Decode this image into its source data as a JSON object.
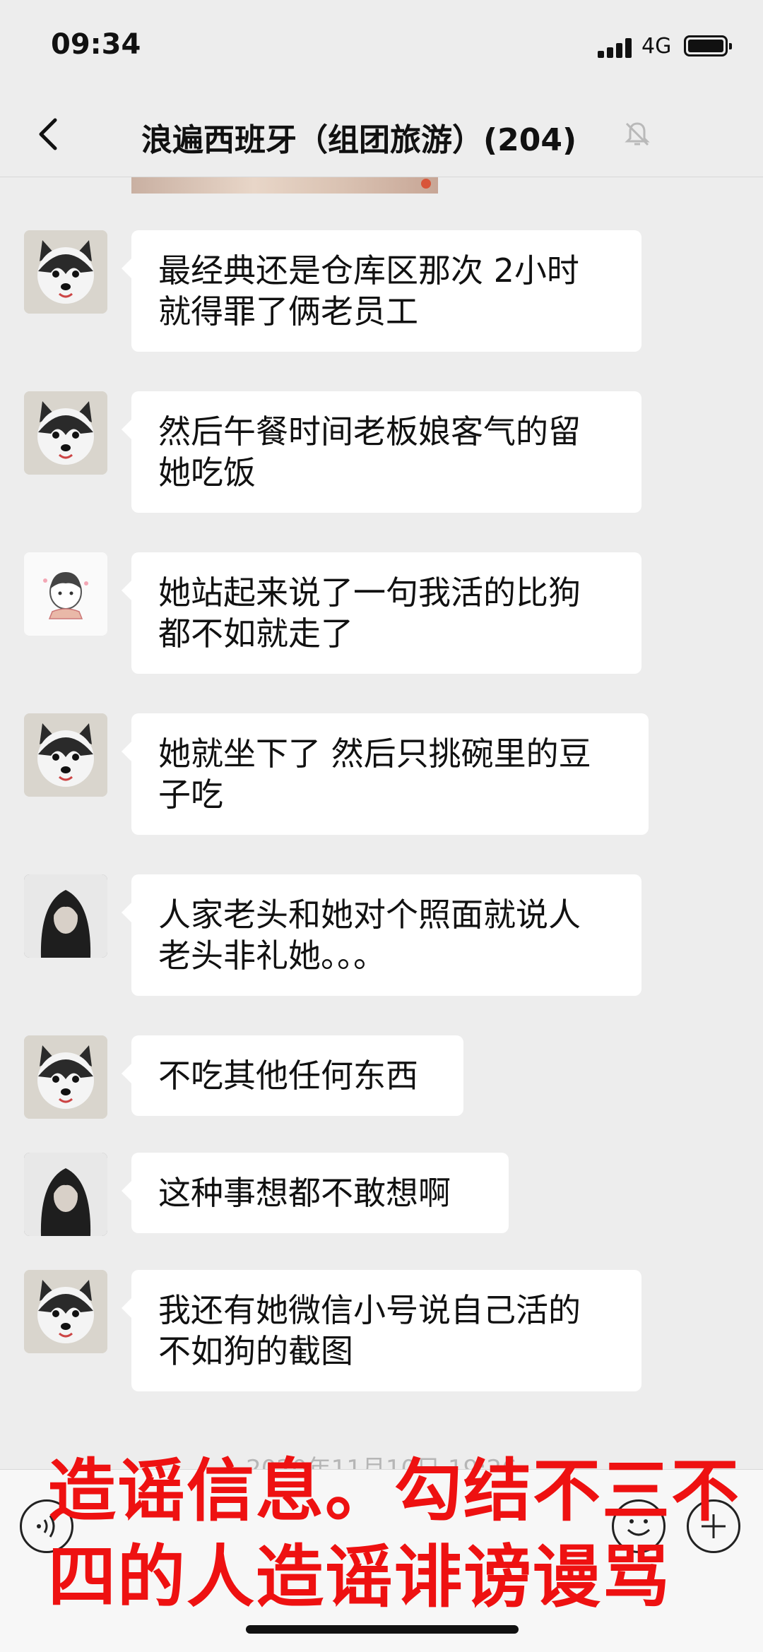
{
  "status_bar": {
    "time": "09:34",
    "network": "4G"
  },
  "nav": {
    "title": "浪遍西班牙（组团旅游）(204)",
    "icons": [
      "back-chevron-icon",
      "mute-bell-icon"
    ]
  },
  "messages": [
    {
      "avatar": "husky-avatar",
      "lines": [
        "最经典还是仓库区那次 2小时",
        "就得罪了俩老员工"
      ]
    },
    {
      "avatar": "husky-avatar",
      "lines": [
        "然后午餐时间老板娘客气的留",
        "她吃饭"
      ]
    },
    {
      "avatar": "cartoon-girl-avatar",
      "lines": [
        "她站起来说了一句我活的比狗",
        "都不如就走了"
      ]
    },
    {
      "avatar": "husky-avatar",
      "lines": [
        "她就坐下了 然后只挑碗里的豆",
        "子吃"
      ]
    },
    {
      "avatar": "dark-hair-girl-avatar",
      "lines": [
        "人家老头和她对个照面就说人",
        "老头非礼她。。。"
      ]
    },
    {
      "avatar": "husky-avatar",
      "lines": [
        "不吃其他任何东西"
      ]
    },
    {
      "avatar": "dark-hair-girl-avatar",
      "lines": [
        "这种事想都不敢想啊"
      ]
    },
    {
      "avatar": "husky-avatar",
      "lines": [
        "我还有她微信小号说自己活的",
        "不如狗的截图"
      ]
    }
  ],
  "timestamp": "2020年11月10日 19:26",
  "input_bar": {
    "icons": [
      "voice-icon",
      "emoji-icon",
      "plus-icon"
    ]
  },
  "overlay": {
    "color": "#ee1111",
    "lines": [
      "造谣信息。勾结不三不",
      "四的人造谣诽谤谩骂"
    ]
  }
}
